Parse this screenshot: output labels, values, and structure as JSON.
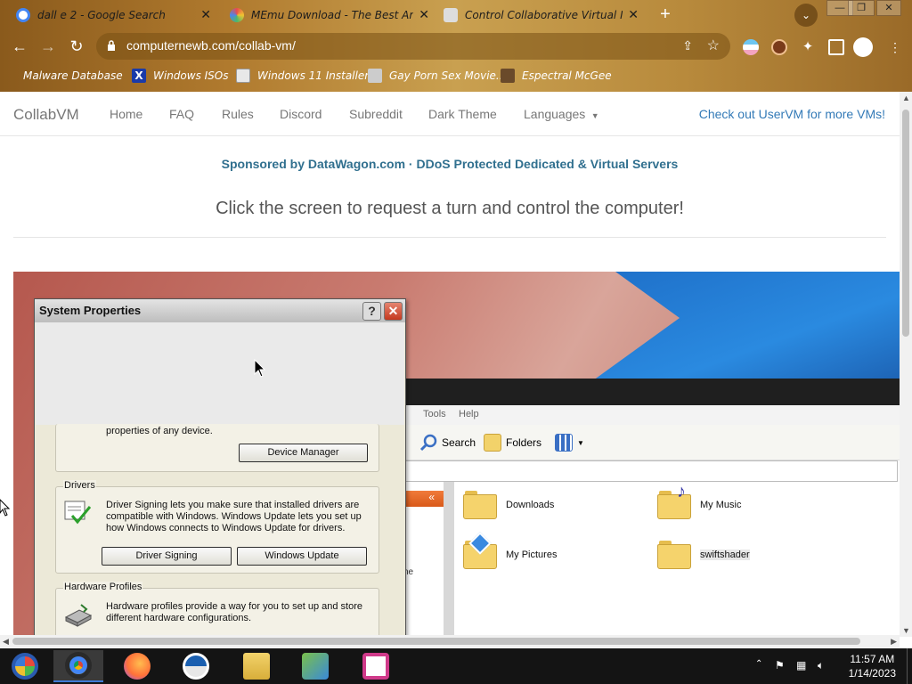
{
  "browser": {
    "tabs": [
      {
        "title": "dall e 2 - Google Search"
      },
      {
        "title": "MEmu Download - The Best Andr"
      },
      {
        "title": "Control Collaborative Virtual Mac"
      }
    ],
    "url": "computernewb.com/collab-vm/",
    "bookmarks": [
      {
        "label": "Malware Database"
      },
      {
        "label": "Windows ISOs"
      },
      {
        "label": "Windows 11 Installer"
      },
      {
        "label": "Gay Porn Sex Movie..."
      },
      {
        "label": "Espectral McGee"
      }
    ]
  },
  "site": {
    "brand": "CollabVM",
    "nav": [
      "Home",
      "FAQ",
      "Rules",
      "Discord",
      "Subreddit",
      "Dark Theme",
      "Languages"
    ],
    "right_link": "Check out UserVM for more VMs!",
    "sponsor": "Sponsored by DataWagon.com · DDoS Protected Dedicated & Virtual Servers",
    "prompt": "Click the screen to request a turn and control the computer!"
  },
  "vm": {
    "explorer": {
      "menu": [
        "Tools",
        "Help"
      ],
      "toolbar": {
        "search": "Search",
        "folders": "Folders"
      },
      "left_fragment": "ne",
      "items": [
        "Downloads",
        "My Music",
        "My Pictures",
        "swiftshader"
      ]
    },
    "dialog": {
      "title": "System Properties",
      "help": "?",
      "close": "✕",
      "device_text": "properties of any device.",
      "device_manager": "Device Manager",
      "drivers_label": "Drivers",
      "drivers_text": "Driver Signing lets you make sure that installed drivers are compatible with Windows. Windows Update lets you set up how Windows connects to Windows Update for drivers.",
      "driver_signing": "Driver Signing",
      "windows_update": "Windows Update",
      "hw_label": "Hardware Profiles",
      "hw_text": "Hardware profiles provide a way for you to set up and store different hardware configurations."
    }
  },
  "taskbar": {
    "clock_time": "11:57 AM",
    "clock_date": "1/14/2023"
  }
}
